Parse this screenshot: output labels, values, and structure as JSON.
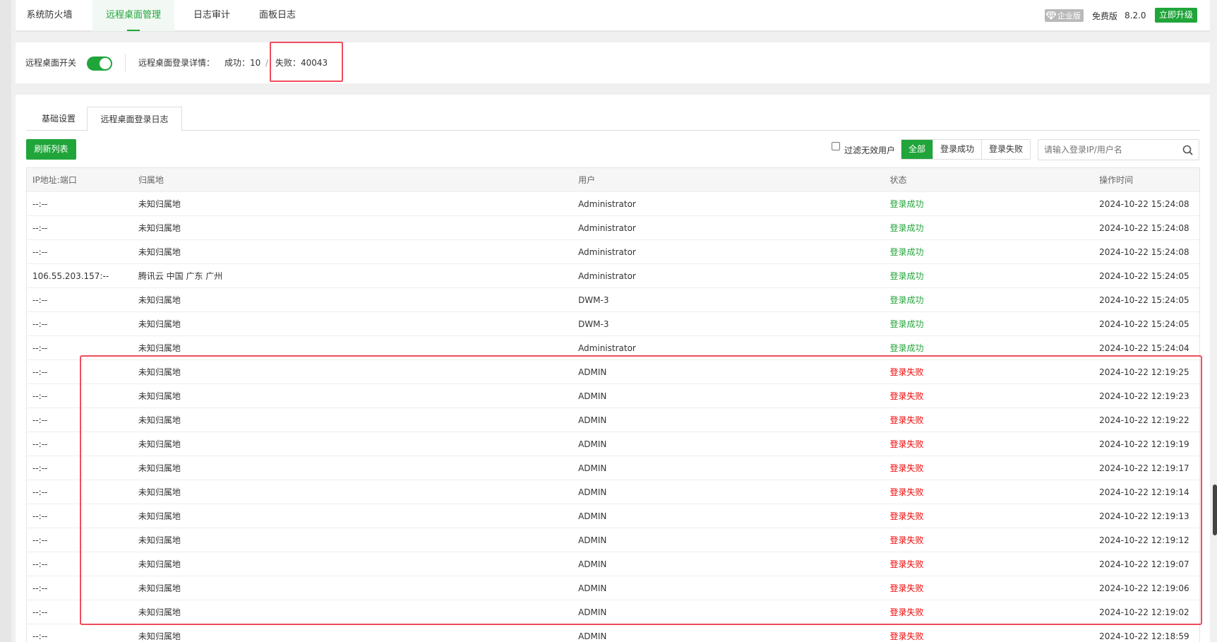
{
  "nav": {
    "tabs": [
      "系统防火墙",
      "远程桌面管理",
      "日志审计",
      "面板日志"
    ],
    "active_index": 1,
    "enterprise_label": "企业版",
    "edition_label": "免费版",
    "version": "8.2.0",
    "upgrade_label": "立即升级"
  },
  "status": {
    "switch_label": "远程桌面开关",
    "switch_on": true,
    "login_detail_label": "远程桌面登录详情：",
    "success_text": "成功：10",
    "divider": "/",
    "fail_text": "失败：40043"
  },
  "panel": {
    "tabs": [
      "基础设置",
      "远程桌面登录日志"
    ],
    "active_index": 1,
    "refresh_label": "刷新列表",
    "filter_label": "过滤无效用户",
    "segments": [
      "全部",
      "登录成功",
      "登录失败"
    ],
    "segment_active": 0,
    "search_placeholder": "请输入登录IP/用户名"
  },
  "table": {
    "columns": [
      "IP地址:端口",
      "归属地",
      "用户",
      "状态",
      "操作时间"
    ],
    "rows": [
      [
        "--:--",
        "未知归属地",
        "Administrator",
        "登录成功",
        "2024-10-22 15:24:08"
      ],
      [
        "--:--",
        "未知归属地",
        "Administrator",
        "登录成功",
        "2024-10-22 15:24:08"
      ],
      [
        "--:--",
        "未知归属地",
        "Administrator",
        "登录成功",
        "2024-10-22 15:24:08"
      ],
      [
        "106.55.203.157:--",
        "腾讯云 中国 广东 广州",
        "Administrator",
        "登录成功",
        "2024-10-22 15:24:05"
      ],
      [
        "--:--",
        "未知归属地",
        "DWM-3",
        "登录成功",
        "2024-10-22 15:24:05"
      ],
      [
        "--:--",
        "未知归属地",
        "DWM-3",
        "登录成功",
        "2024-10-22 15:24:05"
      ],
      [
        "--:--",
        "未知归属地",
        "Administrator",
        "登录成功",
        "2024-10-22 15:24:04"
      ],
      [
        "--:--",
        "未知归属地",
        "ADMIN",
        "登录失败",
        "2024-10-22 12:19:25"
      ],
      [
        "--:--",
        "未知归属地",
        "ADMIN",
        "登录失败",
        "2024-10-22 12:19:23"
      ],
      [
        "--:--",
        "未知归属地",
        "ADMIN",
        "登录失败",
        "2024-10-22 12:19:22"
      ],
      [
        "--:--",
        "未知归属地",
        "ADMIN",
        "登录失败",
        "2024-10-22 12:19:19"
      ],
      [
        "--:--",
        "未知归属地",
        "ADMIN",
        "登录失败",
        "2024-10-22 12:19:17"
      ],
      [
        "--:--",
        "未知归属地",
        "ADMIN",
        "登录失败",
        "2024-10-22 12:19:14"
      ],
      [
        "--:--",
        "未知归属地",
        "ADMIN",
        "登录失败",
        "2024-10-22 12:19:13"
      ],
      [
        "--:--",
        "未知归属地",
        "ADMIN",
        "登录失败",
        "2024-10-22 12:19:12"
      ],
      [
        "--:--",
        "未知归属地",
        "ADMIN",
        "登录失败",
        "2024-10-22 12:19:07"
      ],
      [
        "--:--",
        "未知归属地",
        "ADMIN",
        "登录失败",
        "2024-10-22 12:19:06"
      ],
      [
        "--:--",
        "未知归属地",
        "ADMIN",
        "登录失败",
        "2024-10-22 12:19:02"
      ],
      [
        "--:--",
        "未知归属地",
        "ADMIN",
        "登录失败",
        "2024-10-22 12:18:59"
      ]
    ]
  },
  "colors": {
    "accent": "#20a53a",
    "fail": "#ef0808",
    "highlight": "#ef4c5c"
  }
}
